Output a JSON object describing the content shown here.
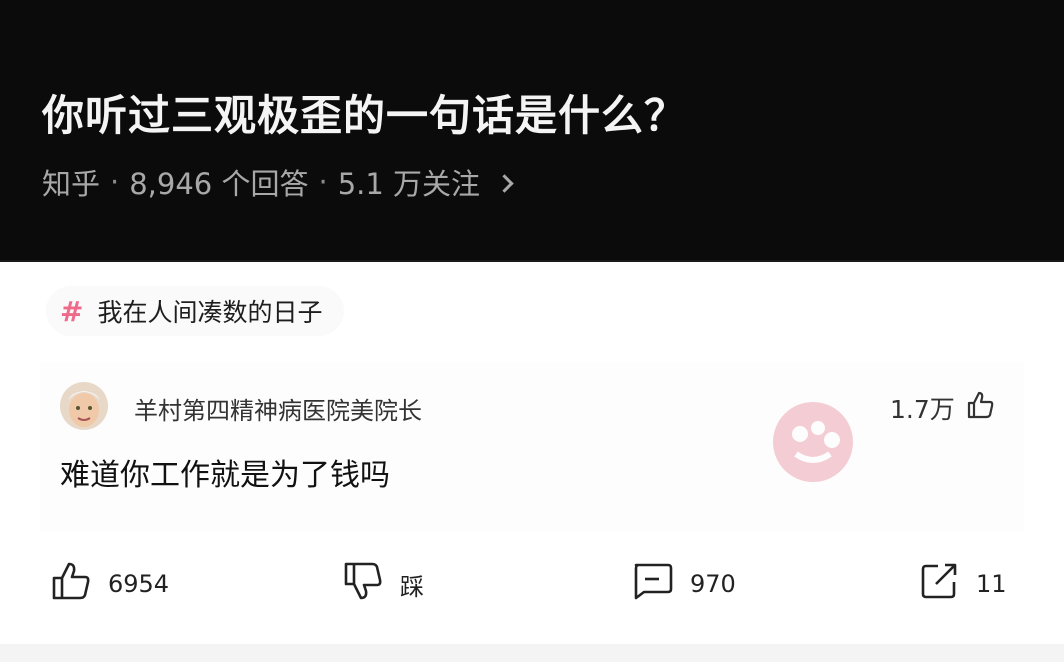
{
  "question": {
    "title": "你听过三观极歪的一句话是什么？",
    "source": "知乎",
    "answers": "8,946 个回答",
    "followers": "5.1 万关注"
  },
  "topic": {
    "label": "我在人间凑数的日子"
  },
  "comment": {
    "username": "羊村第四精神病医院美院长",
    "text": "难道你工作就是为了钱吗",
    "likes": "1.7万"
  },
  "actions": {
    "upvotes": "6954",
    "downvote_label": "踩",
    "comments": "970",
    "shares": "11"
  },
  "colors": {
    "header_bg": "#0b0b0b",
    "hash_accent": "#ee6b8c"
  }
}
